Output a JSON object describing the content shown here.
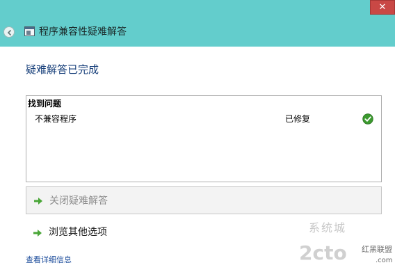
{
  "window": {
    "title": "程序兼容性疑难解答",
    "close_icon": "close-icon",
    "back_icon": "back-arrow-icon",
    "app_icon": "compatibility-troubleshooter-icon"
  },
  "main": {
    "heading": "疑难解答已完成",
    "problems_panel": {
      "header": "找到问题",
      "rows": [
        {
          "name": "不兼容程序",
          "status": "已修复",
          "status_icon": "green-check-icon"
        }
      ]
    },
    "actions": {
      "close_label": "关闭疑难解答",
      "explore_label": "浏览其他选项",
      "arrow_icon": "green-arrow-icon"
    },
    "details_link": "查看详细信息"
  },
  "watermark": {
    "line1": "系统城",
    "line2": "2cto",
    "line3": "红黑联盟",
    ".com": ".com"
  },
  "colors": {
    "titlebar": "#63cdcc",
    "close_button": "#c94845",
    "heading": "#173f7a",
    "link": "#1e4e9c",
    "check_green": "#3c9a2f"
  }
}
